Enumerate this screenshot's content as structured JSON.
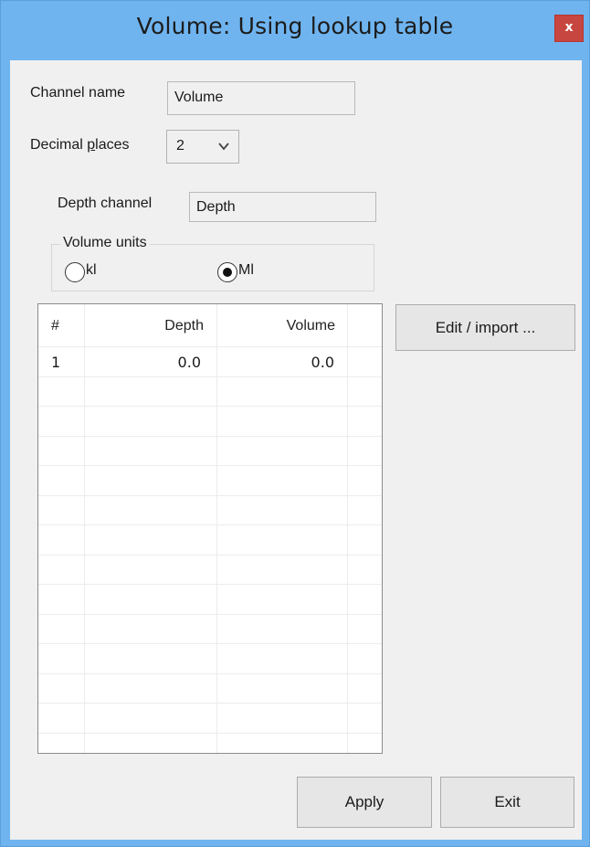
{
  "window": {
    "title": "Volume: Using lookup table",
    "close_label": "x",
    "accent_color": "#6fb4ef",
    "close_color": "#c7463f"
  },
  "form": {
    "channel_name_label": "Channel name",
    "channel_name_value": "Volume",
    "decimal_places_label_pre": "Decimal ",
    "decimal_places_label_mnemonic": "p",
    "decimal_places_label_post": "laces",
    "decimal_places_value": "2",
    "depth_channel_label": "Depth channel",
    "depth_channel_value": "Depth"
  },
  "volume_units": {
    "legend": "Volume units",
    "options": [
      {
        "label": "kl",
        "selected": false
      },
      {
        "label": "Ml",
        "selected": true
      }
    ]
  },
  "table": {
    "columns": [
      "#",
      "Depth",
      "Volume"
    ],
    "rows": [
      {
        "index": "1",
        "depth": "0.0",
        "volume": "0.0"
      }
    ]
  },
  "buttons": {
    "edit_import": "Edit / import ...",
    "apply": "Apply",
    "exit": "Exit"
  }
}
